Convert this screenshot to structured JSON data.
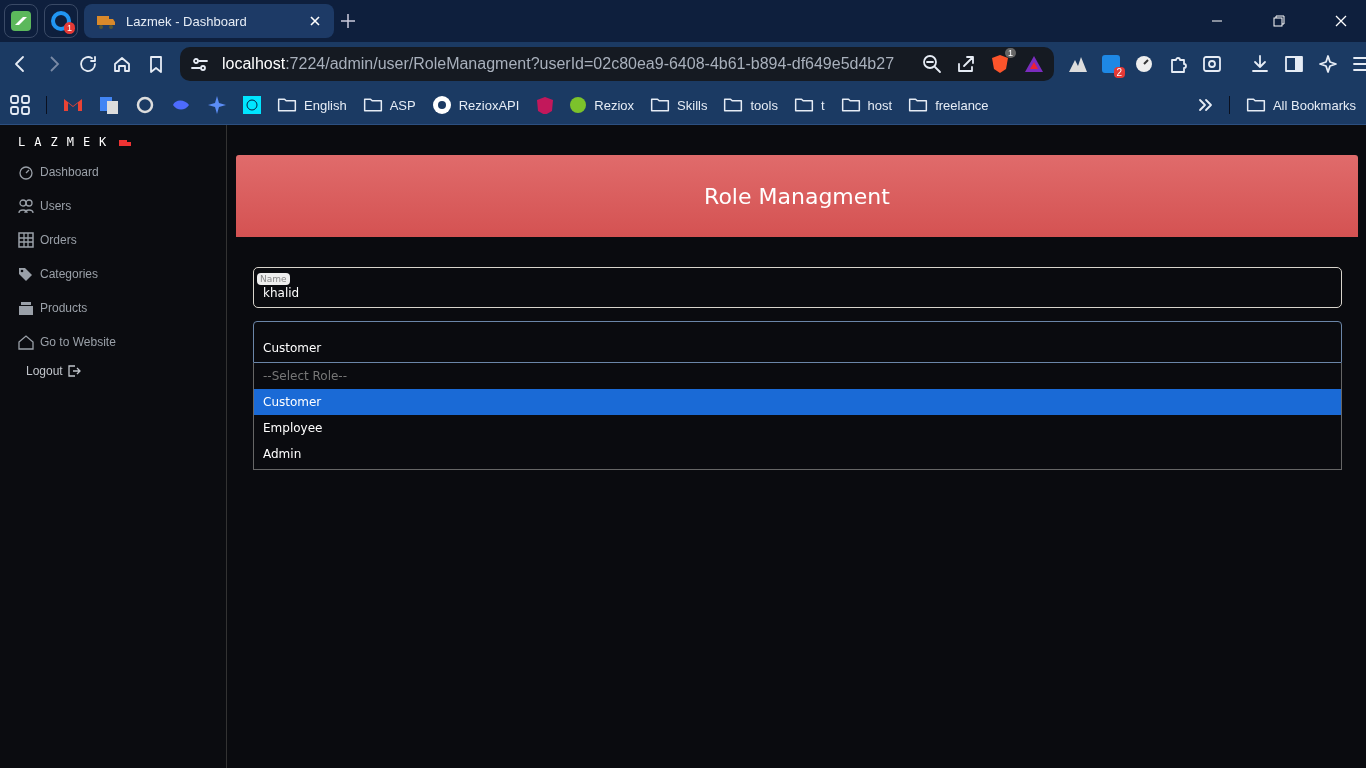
{
  "browser": {
    "tabs": [
      {
        "title": "Lazmek - Dashboard",
        "selected": true
      }
    ],
    "pinned_badge": "1",
    "address": {
      "host": "localhost",
      "path": ":7224/admin/user/RoleManagment?userId=02c80ea9-6408-4b61-b894-df649e5d4b27"
    },
    "shield_badge": "1",
    "extension_badge": "2",
    "bookmarks": [
      {
        "label": "English",
        "kind": "folder"
      },
      {
        "label": "ASP",
        "kind": "folder"
      },
      {
        "label": "RezioxAPI",
        "kind": "github"
      },
      {
        "label": "Reziox",
        "kind": "site"
      },
      {
        "label": "Skills",
        "kind": "folder"
      },
      {
        "label": "tools",
        "kind": "folder"
      },
      {
        "label": "t",
        "kind": "folder"
      },
      {
        "label": "host",
        "kind": "folder"
      },
      {
        "label": "freelance",
        "kind": "folder"
      }
    ],
    "all_bookmarks": "All Bookmarks"
  },
  "sidebar": {
    "logo": "LAZMEK",
    "items": [
      {
        "label": "Dashboard",
        "kind": "gauge"
      },
      {
        "label": "Users",
        "kind": "users"
      },
      {
        "label": "Orders",
        "kind": "grid"
      },
      {
        "label": "Categories",
        "kind": "tag"
      },
      {
        "label": "Products",
        "kind": "box"
      },
      {
        "label": "Go to Website",
        "kind": "home"
      }
    ],
    "logout": "Logout"
  },
  "page": {
    "title": "Role Managment",
    "name_field": {
      "label": "Name",
      "value": "khalid"
    },
    "role_select": {
      "value": "Customer",
      "options": [
        {
          "label": "--Select Role--",
          "kind": "placeholder",
          "selected": false
        },
        {
          "label": "Customer",
          "kind": "option",
          "selected": true
        },
        {
          "label": "Employee",
          "kind": "option",
          "selected": false
        },
        {
          "label": "Admin",
          "kind": "option",
          "selected": false
        }
      ]
    }
  }
}
